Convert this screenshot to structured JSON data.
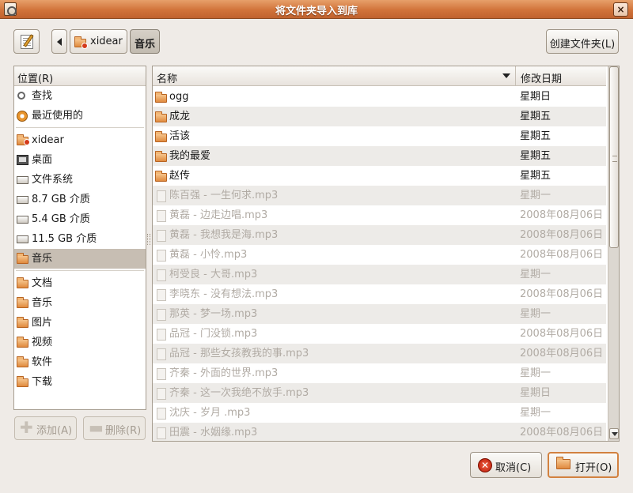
{
  "window": {
    "title": "将文件夹导入到库",
    "close_symbol": "×"
  },
  "toolbar": {
    "path": [
      "xidear",
      "音乐"
    ],
    "create_folder_label": "创建文件夹(L)"
  },
  "sidebar": {
    "header": "位置(R)",
    "items": [
      {
        "label": "查找",
        "icon": "search-icon"
      },
      {
        "label": "最近使用的",
        "icon": "recent-icon"
      },
      {
        "label": "xidear",
        "icon": "home-folder-icon"
      },
      {
        "label": "桌面",
        "icon": "desktop-icon"
      },
      {
        "label": "文件系统",
        "icon": "drive-icon"
      },
      {
        "label": "8.7 GB 介质",
        "icon": "drive-icon"
      },
      {
        "label": "5.4 GB 介质",
        "icon": "drive-icon"
      },
      {
        "label": "11.5 GB 介质",
        "icon": "drive-icon"
      },
      {
        "label": "音乐",
        "icon": "folder-icon",
        "selected": true
      },
      {
        "label": "文档",
        "icon": "folder-icon"
      },
      {
        "label": "音乐",
        "icon": "folder-icon"
      },
      {
        "label": "图片",
        "icon": "folder-icon"
      },
      {
        "label": "视频",
        "icon": "folder-icon"
      },
      {
        "label": "软件",
        "icon": "folder-icon"
      },
      {
        "label": "下载",
        "icon": "folder-icon"
      }
    ],
    "add_label": "添加(A)",
    "remove_label": "删除(R)"
  },
  "files": {
    "columns": {
      "name": "名称",
      "modified": "修改日期"
    },
    "rows": [
      {
        "name": "ogg",
        "date": "星期日",
        "type": "folder"
      },
      {
        "name": "成龙",
        "date": "星期五",
        "type": "folder"
      },
      {
        "name": "活该",
        "date": "星期五",
        "type": "folder"
      },
      {
        "name": "我的最爱",
        "date": "星期五",
        "type": "folder"
      },
      {
        "name": "赵传",
        "date": "星期五",
        "type": "folder"
      },
      {
        "name": "陈百强 - 一生何求.mp3",
        "date": "星期一",
        "type": "file"
      },
      {
        "name": "黄磊 - 边走边唱.mp3",
        "date": "2008年08月06日",
        "type": "file"
      },
      {
        "name": "黄磊 - 我想我是海.mp3",
        "date": "2008年08月06日",
        "type": "file"
      },
      {
        "name": "黄磊 - 小怜.mp3",
        "date": "2008年08月06日",
        "type": "file"
      },
      {
        "name": "柯受良 - 大哥.mp3",
        "date": "星期一",
        "type": "file"
      },
      {
        "name": "李晓东 - 没有想法.mp3",
        "date": "2008年08月06日",
        "type": "file"
      },
      {
        "name": "那英 - 梦一场.mp3",
        "date": "星期一",
        "type": "file"
      },
      {
        "name": "品冠 - 门没锁.mp3",
        "date": "2008年08月06日",
        "type": "file"
      },
      {
        "name": "品冠 - 那些女孩教我的事.mp3",
        "date": "2008年08月06日",
        "type": "file"
      },
      {
        "name": "齐秦 - 外面的世界.mp3",
        "date": "星期一",
        "type": "file"
      },
      {
        "name": "齐秦 - 这一次我绝不放手.mp3",
        "date": "星期日",
        "type": "file"
      },
      {
        "name": "沈庆 - 岁月  .mp3",
        "date": "星期一",
        "type": "file"
      },
      {
        "name": "田震 - 水姻缘.mp3",
        "date": "2008年08月06日",
        "type": "file"
      }
    ]
  },
  "buttons": {
    "cancel_label": "取消(C)",
    "open_label": "打开(O)"
  },
  "colors": {
    "titlebar": "#d1733a",
    "selection": "#c7beb3",
    "folder": "#e08a3e"
  }
}
